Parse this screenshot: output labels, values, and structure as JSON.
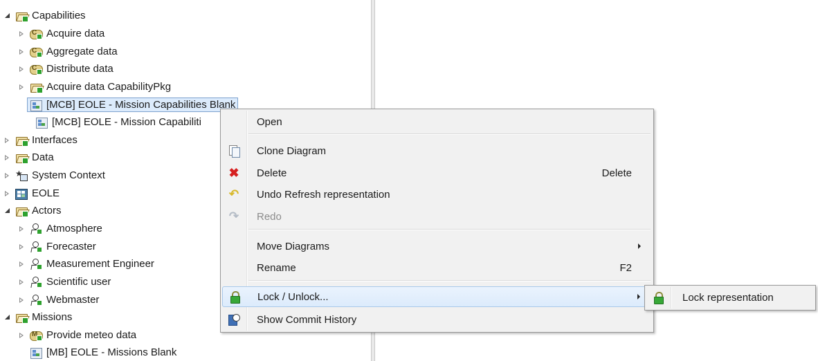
{
  "tree": {
    "items": [
      {
        "label": "Capabilities",
        "icon": "folder-icon",
        "expanded": true
      },
      {
        "label": "Acquire data",
        "icon": "capability-icon"
      },
      {
        "label": "Aggregate data",
        "icon": "capability-icon"
      },
      {
        "label": "Distribute data",
        "icon": "capability-icon"
      },
      {
        "label": "Acquire data CapabilityPkg",
        "icon": "folder-icon"
      },
      {
        "label": "[MCB] EOLE - Mission Capabilities Blank",
        "icon": "diagram-icon",
        "selected": true
      },
      {
        "label": "[MCB] EOLE - Mission Capabiliti",
        "icon": "diagram-icon"
      },
      {
        "label": "Interfaces",
        "icon": "folder-icon"
      },
      {
        "label": "Data",
        "icon": "folder-icon"
      },
      {
        "label": "System Context",
        "icon": "system-context-icon"
      },
      {
        "label": "EOLE",
        "icon": "system-icon"
      },
      {
        "label": "Actors",
        "icon": "folder-icon",
        "expanded": true
      },
      {
        "label": "Atmosphere",
        "icon": "actor-icon"
      },
      {
        "label": "Forecaster",
        "icon": "actor-icon"
      },
      {
        "label": "Measurement Engineer",
        "icon": "actor-icon"
      },
      {
        "label": "Scientific user",
        "icon": "actor-icon"
      },
      {
        "label": "Webmaster",
        "icon": "actor-icon"
      },
      {
        "label": "Missions",
        "icon": "folder-icon",
        "expanded": true
      },
      {
        "label": "Provide meteo data",
        "icon": "mission-icon"
      },
      {
        "label": "[MB] EOLE - Missions Blank",
        "icon": "diagram-icon"
      }
    ]
  },
  "context_menu": {
    "items": [
      {
        "label": "Open"
      },
      {
        "label": "Clone Diagram",
        "icon": "clone-icon"
      },
      {
        "label": "Delete",
        "icon": "delete-icon",
        "shortcut": "Delete"
      },
      {
        "label": "Undo Refresh representation",
        "icon": "undo-icon"
      },
      {
        "label": "Redo",
        "icon": "redo-icon",
        "disabled": true
      },
      {
        "label": "Move Diagrams",
        "submenu": true
      },
      {
        "label": "Rename",
        "shortcut": "F2"
      },
      {
        "label": "Lock / Unlock...",
        "icon": "lock-icon",
        "submenu": true,
        "highlighted": true
      },
      {
        "label": "Show Commit History",
        "icon": "commit-history-icon"
      }
    ]
  },
  "submenu": {
    "items": [
      {
        "label": "Lock representation",
        "icon": "lock-icon"
      }
    ]
  }
}
